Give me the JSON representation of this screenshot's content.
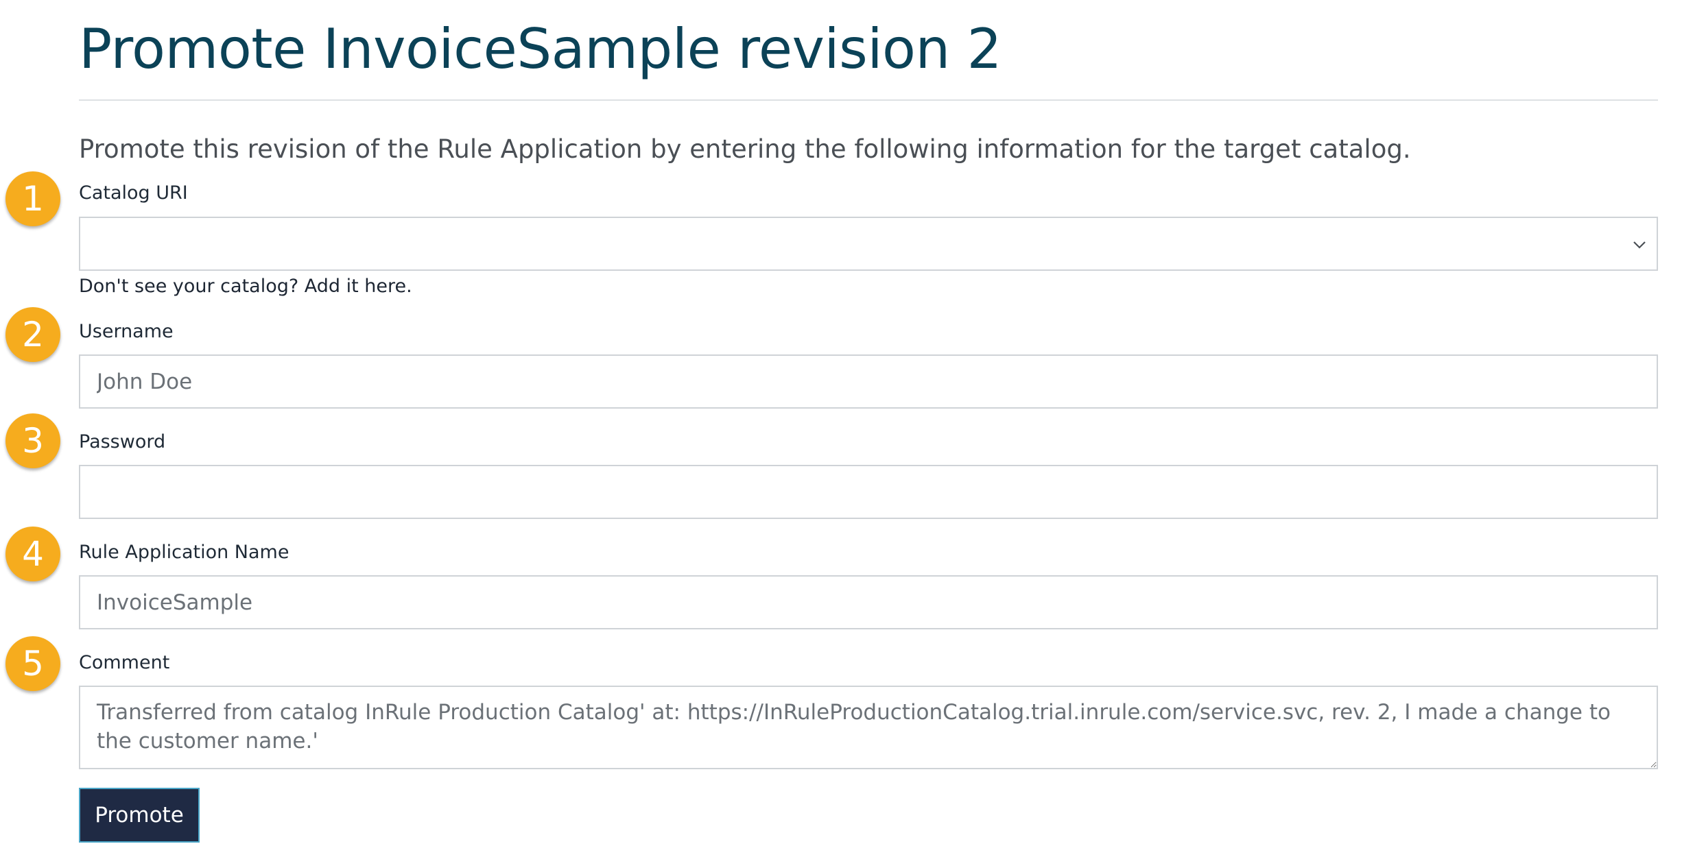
{
  "header": {
    "title": "Promote InvoiceSample revision 2",
    "intro": "Promote this revision of the Rule Application by entering the following information for the target catalog."
  },
  "steps": [
    "1",
    "2",
    "3",
    "4",
    "5"
  ],
  "form": {
    "catalog_uri": {
      "label": "Catalog URI",
      "value": "",
      "hint_link": "Don't see your catalog? Add it here."
    },
    "username": {
      "label": "Username",
      "value": "",
      "placeholder": "John Doe"
    },
    "password": {
      "label": "Password",
      "value": ""
    },
    "rule_app_name": {
      "label": "Rule Application Name",
      "value": "InvoiceSample"
    },
    "comment": {
      "label": "Comment",
      "value": "Transferred from catalog InRule Production Catalog' at: https://InRuleProductionCatalog.trial.inrule.com/service.svc, rev. 2, I made a change to the customer name.'"
    }
  },
  "actions": {
    "promote_label": "Promote"
  },
  "colors": {
    "title": "#0b4257",
    "badge": "#f6ac1e",
    "button_bg": "#1f2a44",
    "button_border": "#4aa6c8"
  },
  "icons": {
    "select_arrow": "chevron-down-icon"
  }
}
